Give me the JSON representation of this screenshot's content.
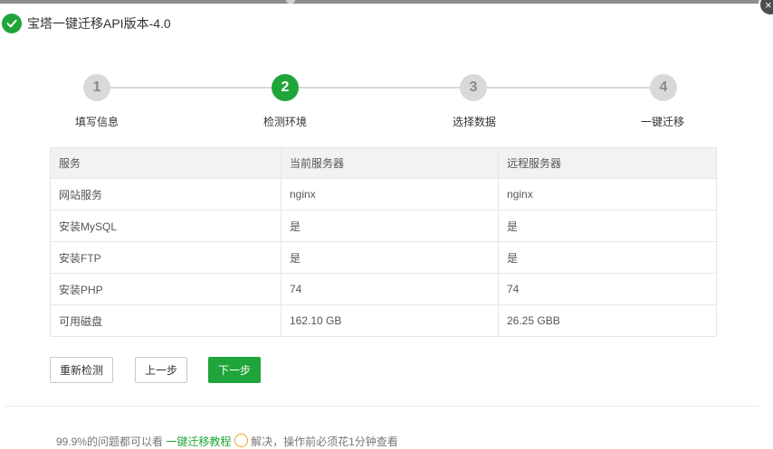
{
  "window": {
    "title": "宝塔一键迁移API版本-4.0",
    "close_glyph": "×"
  },
  "steps": [
    {
      "number": "1",
      "label": "填写信息",
      "state": "done"
    },
    {
      "number": "2",
      "label": "检测环境",
      "state": "active"
    },
    {
      "number": "3",
      "label": "选择数据",
      "state": "pending"
    },
    {
      "number": "4",
      "label": "一键迁移",
      "state": "pending"
    }
  ],
  "table": {
    "headers": [
      "服务",
      "当前服务器",
      "远程服务器"
    ],
    "rows": [
      [
        "网站服务",
        "nginx",
        "nginx"
      ],
      [
        "安装MySQL",
        "是",
        "是"
      ],
      [
        "安装FTP",
        "是",
        "是"
      ],
      [
        "安装PHP",
        "74",
        "74"
      ],
      [
        "可用磁盘",
        "162.10 GB",
        "26.25 GBB"
      ]
    ]
  },
  "buttons": {
    "recheck": "重新检测",
    "prev": "上一步",
    "next": "下一步"
  },
  "footer": {
    "prefix": "99.9%的问题都可以看",
    "link": "一键迁移教程",
    "middle": "解决，操作前必须花1分钟查看"
  },
  "colors": {
    "accent": "#20a53a",
    "step_inactive": "#d9d9d9"
  },
  "icons": {
    "title": "check-circle-icon",
    "close": "close-icon",
    "footer": "help-circle-icon"
  }
}
